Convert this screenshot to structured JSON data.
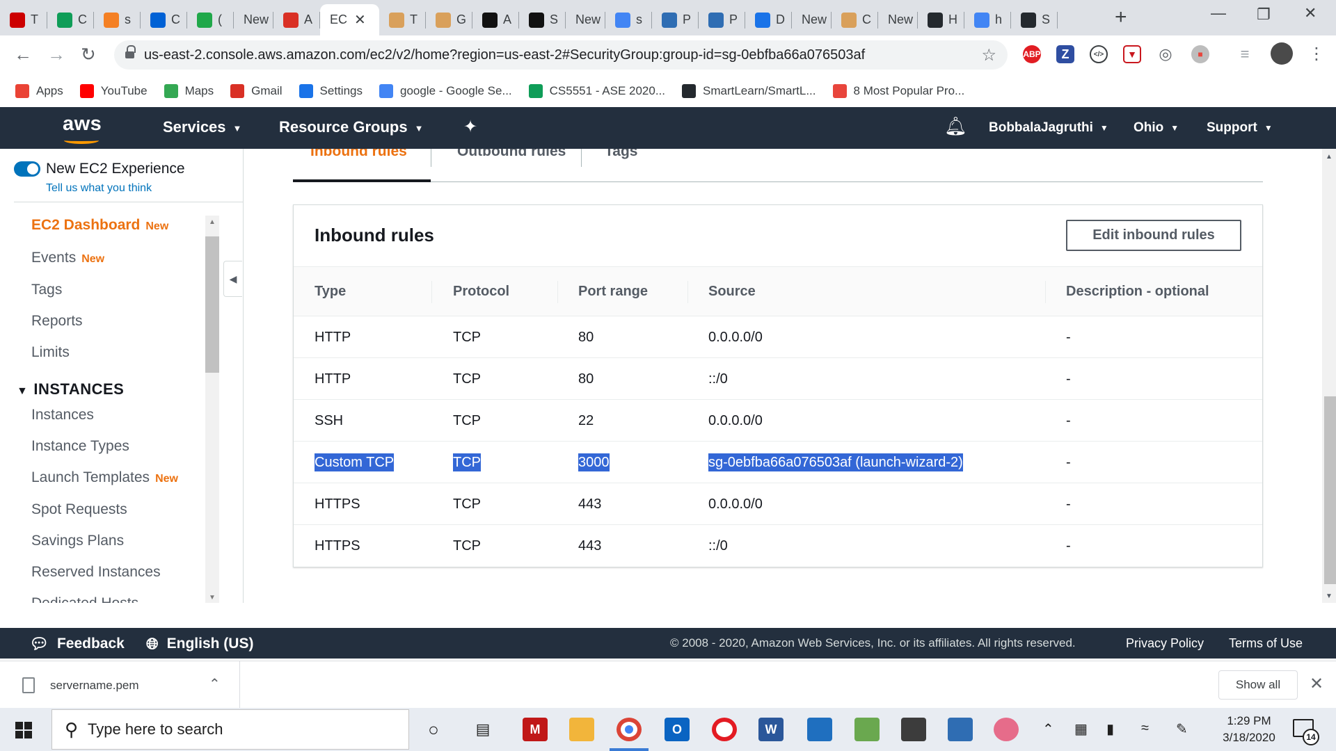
{
  "browser": {
    "tabs": [
      {
        "label": "T",
        "icon": "target-icon",
        "color": "#cc0000"
      },
      {
        "label": "C",
        "icon": "plus-icon",
        "color": "#0f9d58"
      },
      {
        "label": "s",
        "icon": "stack-icon",
        "color": "#f48024"
      },
      {
        "label": "C",
        "icon": "box-icon",
        "color": "#0061d5"
      },
      {
        "label": "(",
        "icon": "one-icon",
        "color": "#20a84a"
      },
      {
        "label": "New",
        "icon": "",
        "color": ""
      },
      {
        "label": "A",
        "icon": "gmail-icon",
        "color": "#d93025"
      },
      {
        "label": "EC",
        "icon": "",
        "color": ""
      },
      {
        "label": "T",
        "icon": "aws-box-icon",
        "color": "#d9a05b"
      },
      {
        "label": "G",
        "icon": "aws-box-icon",
        "color": "#d9a05b"
      },
      {
        "label": "A",
        "icon": "amazon-icon",
        "color": "#111111"
      },
      {
        "label": "S",
        "icon": "feed-icon",
        "color": "#111111"
      },
      {
        "label": "New",
        "icon": "",
        "color": ""
      },
      {
        "label": "s",
        "icon": "google-icon",
        "color": "#4285f4"
      },
      {
        "label": "P",
        "icon": "window-icon",
        "color": "#2f6db3"
      },
      {
        "label": "P",
        "icon": "window-icon",
        "color": "#2f6db3"
      },
      {
        "label": "D",
        "icon": "download-icon",
        "color": "#1a73e8"
      },
      {
        "label": "New",
        "icon": "",
        "color": ""
      },
      {
        "label": "C",
        "icon": "aws-box-icon",
        "color": "#d9a05b"
      },
      {
        "label": "New",
        "icon": "",
        "color": ""
      },
      {
        "label": "H",
        "icon": "box-dark-icon",
        "color": "#24292e"
      },
      {
        "label": "h",
        "icon": "google-icon",
        "color": "#4285f4"
      },
      {
        "label": "S",
        "icon": "github-icon",
        "color": "#24292e"
      }
    ],
    "url": "us-east-2.console.aws.amazon.com/ec2/v2/home?region=us-east-2#SecurityGroup:group-id=sg-0ebfba66a076503af",
    "bookmarks": [
      {
        "label": "Apps",
        "icon": "apps-grid-icon",
        "color": "#ea4335"
      },
      {
        "label": "YouTube",
        "icon": "youtube-icon",
        "color": "#ff0000"
      },
      {
        "label": "Maps",
        "icon": "maps-pin-icon",
        "color": "#34a853"
      },
      {
        "label": "Gmail",
        "icon": "gmail-icon",
        "color": "#d93025"
      },
      {
        "label": "Settings",
        "icon": "gear-icon",
        "color": "#1a73e8"
      },
      {
        "label": "google - Google Se...",
        "icon": "google-icon",
        "color": "#4285f4"
      },
      {
        "label": "CS5551 - ASE 2020...",
        "icon": "plus-icon",
        "color": "#0f9d58"
      },
      {
        "label": "SmartLearn/SmartL...",
        "icon": "github-icon",
        "color": "#24292e"
      },
      {
        "label": "8 Most Popular Pro...",
        "icon": "mountain-icon",
        "color": "#e8453c"
      }
    ]
  },
  "aws_nav": {
    "logo": "aws",
    "services": "Services",
    "resource_groups": "Resource Groups",
    "user": "BobbalaJagruthi",
    "region": "Ohio",
    "support": "Support"
  },
  "sidebar": {
    "experience_label": "New EC2 Experience",
    "experience_link": "Tell us what you think",
    "new_badge": "New",
    "items": [
      {
        "label": "EC2 Dashboard",
        "new": true,
        "active": true
      },
      {
        "label": "Events",
        "new": true,
        "active": false
      },
      {
        "label": "Tags",
        "new": false,
        "active": false
      },
      {
        "label": "Reports",
        "new": false,
        "active": false
      },
      {
        "label": "Limits",
        "new": false,
        "active": false
      }
    ],
    "section": "INSTANCES",
    "section_items": [
      {
        "label": "Instances",
        "new": false
      },
      {
        "label": "Instance Types",
        "new": false
      },
      {
        "label": "Launch Templates",
        "new": true
      },
      {
        "label": "Spot Requests",
        "new": false
      },
      {
        "label": "Savings Plans",
        "new": false
      },
      {
        "label": "Reserved Instances",
        "new": false
      },
      {
        "label": "Dedicated Hosts",
        "new": false
      }
    ]
  },
  "content": {
    "tabs": [
      "Inbound rules",
      "Outbound rules",
      "Tags"
    ],
    "panel_title": "Inbound rules",
    "edit_button": "Edit inbound rules",
    "columns": [
      "Type",
      "Protocol",
      "Port range",
      "Source",
      "Description - optional"
    ],
    "rows": [
      {
        "type": "HTTP",
        "protocol": "TCP",
        "port": "80",
        "source": "0.0.0.0/0",
        "description": "-",
        "selected": false
      },
      {
        "type": "HTTP",
        "protocol": "TCP",
        "port": "80",
        "source": "::/0",
        "description": "-",
        "selected": false
      },
      {
        "type": "SSH",
        "protocol": "TCP",
        "port": "22",
        "source": "0.0.0.0/0",
        "description": "-",
        "selected": false
      },
      {
        "type": "Custom TCP",
        "protocol": "TCP",
        "port": "3000",
        "source": "sg-0ebfba66a076503af (launch-wizard-2)",
        "description": "-",
        "selected": true
      },
      {
        "type": "HTTPS",
        "protocol": "TCP",
        "port": "443",
        "source": "0.0.0.0/0",
        "description": "-",
        "selected": false
      },
      {
        "type": "HTTPS",
        "protocol": "TCP",
        "port": "443",
        "source": "::/0",
        "description": "-",
        "selected": false
      }
    ]
  },
  "footer": {
    "feedback": "Feedback",
    "language": "English (US)",
    "copyright": "© 2008 - 2020, Amazon Web Services, Inc. or its affiliates. All rights reserved.",
    "privacy": "Privacy Policy",
    "terms": "Terms of Use"
  },
  "downloads": {
    "file": "servername.pem",
    "show_all": "Show all"
  },
  "taskbar": {
    "search_placeholder": "Type here to search",
    "time": "1:29 PM",
    "date": "3/18/2020",
    "notifications": "14"
  },
  "colors": {
    "aws_orange": "#ec7211",
    "aws_nav_bg": "#232f3e",
    "selection": "#3367d6",
    "link_blue": "#0073bb"
  }
}
